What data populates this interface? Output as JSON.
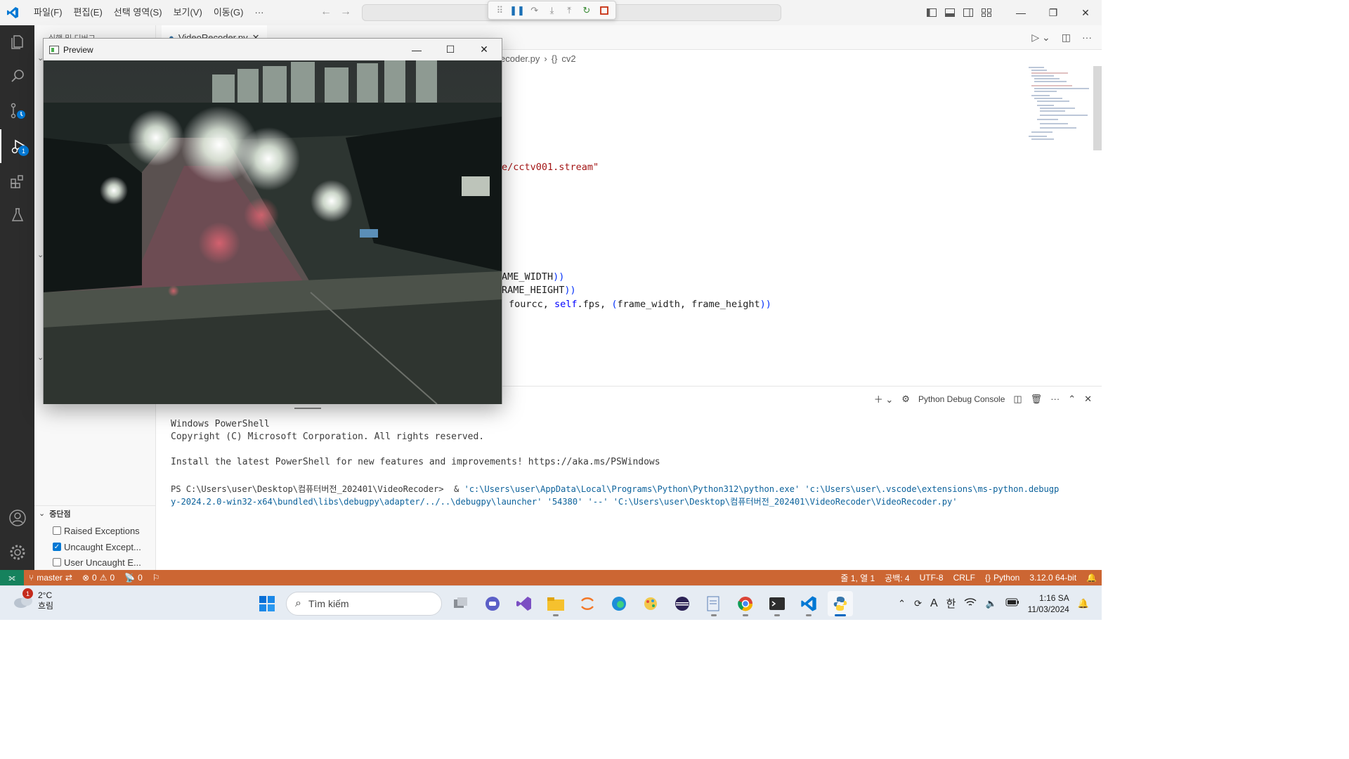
{
  "menu": [
    "파일(F)",
    "편집(E)",
    "선택 영역(S)",
    "보기(V)",
    "이동(G)",
    "···"
  ],
  "tab": {
    "label": "VideoRecoder.py"
  },
  "sidebar": {
    "title": "실행 및 디버그",
    "breakpoints_header": "중단점",
    "breakpoints": [
      {
        "label": "Raised Exceptions",
        "checked": false
      },
      {
        "label": "Uncaught Except...",
        "checked": true
      },
      {
        "label": "User Uncaught E...",
        "checked": false
      }
    ]
  },
  "breadcrumb": {
    "file": "ecoder.py",
    "symbol": "cv2"
  },
  "code": {
    "line1": "e/cctv001.stream\"",
    "line2a": "AME_WIDTH",
    "line2b": "))",
    "line3a": "RAME_HEIGHT",
    "line3b": "))",
    "line4_fourcc": "fourcc, ",
    "line4_self": "self",
    "line4_rest": ".fps, ",
    "line4_paren_open": "(",
    "line4_args": "frame_width, frame_height",
    "line4_paren_close": "))"
  },
  "panel": {
    "console_label": "Python Debug Console",
    "lines": [
      "Windows PowerShell",
      "Copyright (C) Microsoft Corporation. All rights reserved.",
      "Install the latest PowerShell for new features and improvements! https://aka.ms/PSWindows"
    ],
    "prompt": "PS C:\\Users\\user\\Desktop\\컴퓨터버전_202401\\VideoRecoder>  & ",
    "cmd1": "'c:\\Users\\user\\AppData\\Local\\Programs\\Python\\Python312\\python.exe' 'c:\\Users\\user\\.vscode\\extensions\\ms-python.debugp",
    "cmd2": "y-2024.2.0-win32-x64\\bundled\\libs\\debugpy\\adapter/../..\\debugpy\\launcher' '54380' '--' 'C:\\Users\\user\\Desktop\\컴퓨터버전_202401\\VideoRecoder\\VideoRecoder.py'"
  },
  "preview": {
    "title": "Preview"
  },
  "statusbar": {
    "branch": "master",
    "errors": "0",
    "warnings": "0",
    "ports": "0",
    "position": "줄 1, 열 1",
    "spaces": "공백: 4",
    "encoding": "UTF-8",
    "eol": "CRLF",
    "language": "Python",
    "interpreter": "3.12.0 64-bit"
  },
  "activity_badge": "1",
  "taskbar": {
    "weather_temp": "2°C",
    "weather_desc": "흐림",
    "weather_badge": "1",
    "search_placeholder": "Tìm kiếm",
    "ime": "한",
    "font_a": "A",
    "time": "1:16 SA",
    "date": "11/03/2024"
  },
  "colors": {
    "statusbar": "#cc6633",
    "accent": "#0078d4",
    "activitybar": "#2c2c2c"
  }
}
